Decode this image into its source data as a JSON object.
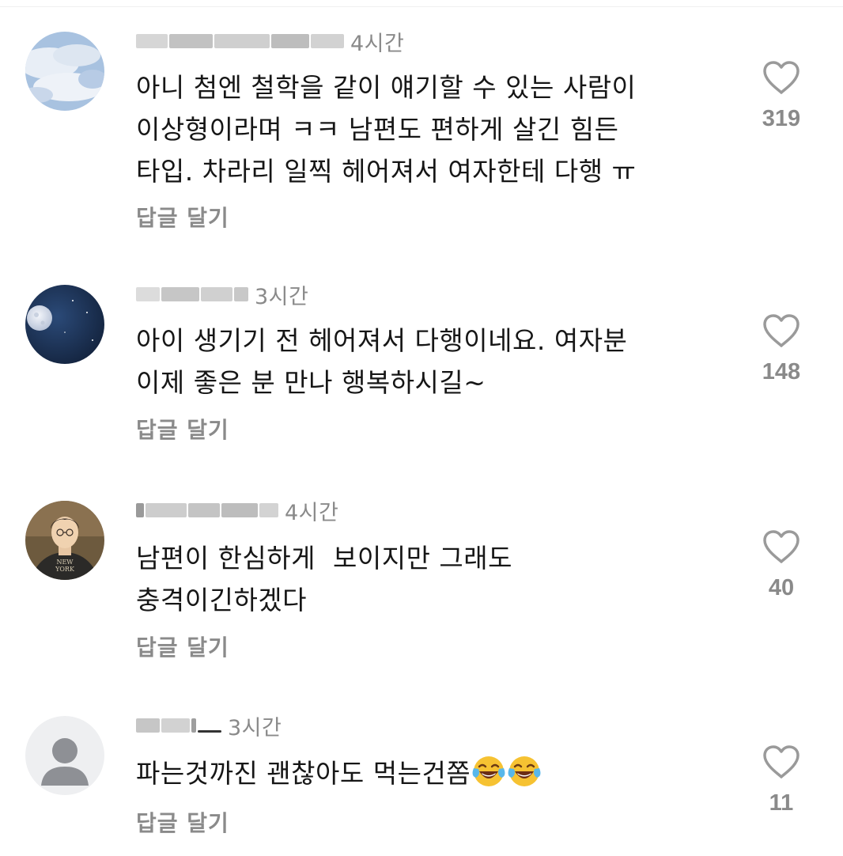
{
  "comments": [
    {
      "time": "4시간",
      "lines": [
        "아니 첨엔 철학을 같이 얘기할 수 있는 사람이",
        "이상형이라며 ㅋㅋ 남편도 편하게 살긴 힘든",
        "타입. 차라리 일찍 헤어져서 여자한테 다행 ㅠ"
      ],
      "reply_label": "답글 달기",
      "likes": "319",
      "avatar": "sky-clouds"
    },
    {
      "time": "3시간",
      "lines": [
        "아이 생기기 전 헤어져서 다행이네요. 여자분",
        "이제 좋은 분 만나 행복하시길~"
      ],
      "reply_label": "답글 달기",
      "likes": "148",
      "avatar": "night-moon"
    },
    {
      "time": "4시간",
      "lines": [
        "남편이 한심하게  보이지만 그래도",
        "충격이긴하겠다"
      ],
      "reply_label": "답글 달기",
      "likes": "40",
      "avatar": "cartoon-person-new-york-hoodie",
      "hoodie_text": [
        "NEW",
        "YORK"
      ]
    },
    {
      "time": "3시간",
      "lines": [
        "파는것까진 괜찮아도 먹는건쫌"
      ],
      "reply_label": "답글 달기",
      "likes": "11",
      "avatar": "default-user-silhouette",
      "trailing_emoji": [
        "face-with-tears-of-joy",
        "face-with-tears-of-joy"
      ]
    }
  ],
  "icons": {
    "like": "heart-outline-icon",
    "emoji": "face-with-tears-of-joy"
  },
  "colors": {
    "meta_gray": "#8a8a8a",
    "text": "#161616",
    "heart_stroke": "#9a9a9a"
  }
}
